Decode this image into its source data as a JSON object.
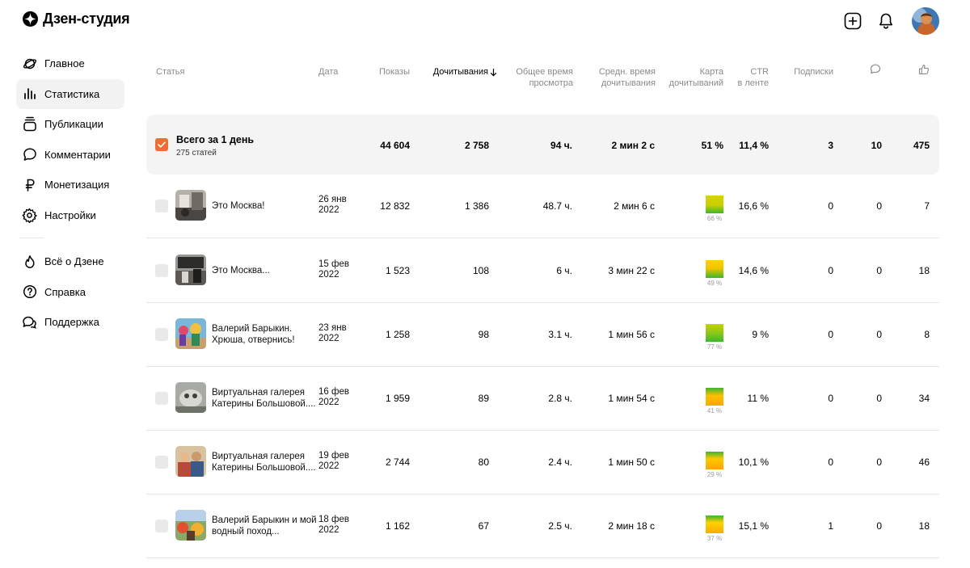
{
  "app": {
    "title": "Дзен-студия"
  },
  "sidebar": {
    "items": [
      {
        "label": "Главное",
        "icon": "planet-icon"
      },
      {
        "label": "Статистика",
        "icon": "bar-chart-icon"
      },
      {
        "label": "Публикации",
        "icon": "stack-icon"
      },
      {
        "label": "Комментарии",
        "icon": "comment-icon"
      },
      {
        "label": "Монетизация",
        "icon": "ruble-icon"
      },
      {
        "label": "Настройки",
        "icon": "gear-icon"
      }
    ],
    "secondary": [
      {
        "label": "Всё о Дзене",
        "icon": "flame-icon"
      },
      {
        "label": "Справка",
        "icon": "help-icon"
      },
      {
        "label": "Поддержка",
        "icon": "chat-icon"
      }
    ]
  },
  "table": {
    "headers": {
      "article": "Статья",
      "date": "Дата",
      "views": "Показы",
      "reads": "Дочитывания",
      "total_time_1": "Общее время",
      "total_time_2": "просмотра",
      "avg_time_1": "Средн. время",
      "avg_time_2": "дочитывания",
      "map_1": "Карта",
      "map_2": "дочитываний",
      "ctr_1": "CTR",
      "ctr_2": "в ленте",
      "subs": "Подписки"
    },
    "summary": {
      "title": "Всего за 1 день",
      "subtitle": "275 статей",
      "views": "44 604",
      "reads": "2 758",
      "total_time": "94 ч.",
      "avg_time": "2 мин 2 с",
      "map": "51 %",
      "ctr": "11,4 %",
      "subs": "3",
      "comments": "10",
      "likes": "475"
    },
    "rows": [
      {
        "title_1": "Это Москва!",
        "title_2": "",
        "date_1": "26 янв",
        "date_2": "2022",
        "views": "12 832",
        "reads": "1 386",
        "total_time": "48.7 ч.",
        "avg_time": "2 мин 6 с",
        "map_pct": "66 %",
        "ctr": "16,6 %",
        "subs": "0",
        "comments": "0",
        "likes": "7"
      },
      {
        "title_1": "Это Москва...",
        "title_2": "",
        "date_1": "15 фев",
        "date_2": "2022",
        "views": "1 523",
        "reads": "108",
        "total_time": "6 ч.",
        "avg_time": "3 мин 22 с",
        "map_pct": "49 %",
        "ctr": "14,6 %",
        "subs": "0",
        "comments": "0",
        "likes": "18"
      },
      {
        "title_1": "Валерий Барыкин.",
        "title_2": "Хрюша, отвернись!",
        "date_1": "23 янв",
        "date_2": "2022",
        "views": "1 258",
        "reads": "98",
        "total_time": "3.1 ч.",
        "avg_time": "1 мин 56 с",
        "map_pct": "77 %",
        "ctr": "9 %",
        "subs": "0",
        "comments": "0",
        "likes": "8"
      },
      {
        "title_1": "Виртуальная галерея",
        "title_2": "Катерины Большовой....",
        "date_1": "16 фев",
        "date_2": "2022",
        "views": "1 959",
        "reads": "89",
        "total_time": "2.8 ч.",
        "avg_time": "1 мин 54 с",
        "map_pct": "41 %",
        "ctr": "11 %",
        "subs": "0",
        "comments": "0",
        "likes": "34"
      },
      {
        "title_1": "Виртуальная галерея",
        "title_2": "Катерины Большовой....",
        "date_1": "19 фев",
        "date_2": "2022",
        "views": "2 744",
        "reads": "80",
        "total_time": "2.4 ч.",
        "avg_time": "1 мин 50 с",
        "map_pct": "29 %",
        "ctr": "10,1 %",
        "subs": "0",
        "comments": "0",
        "likes": "46"
      },
      {
        "title_1": "Валерий Барыкин и мой",
        "title_2": "водный поход...",
        "date_1": "18 фев",
        "date_2": "2022",
        "views": "1 162",
        "reads": "67",
        "total_time": "2.5 ч.",
        "avg_time": "2 мин 18 с",
        "map_pct": "37 %",
        "ctr": "15,1 %",
        "subs": "1",
        "comments": "0",
        "likes": "18"
      }
    ]
  },
  "colors": {
    "accent": "#f26b32",
    "heat_top": "#d8d400",
    "heat_bottom": "#3cb62e"
  }
}
